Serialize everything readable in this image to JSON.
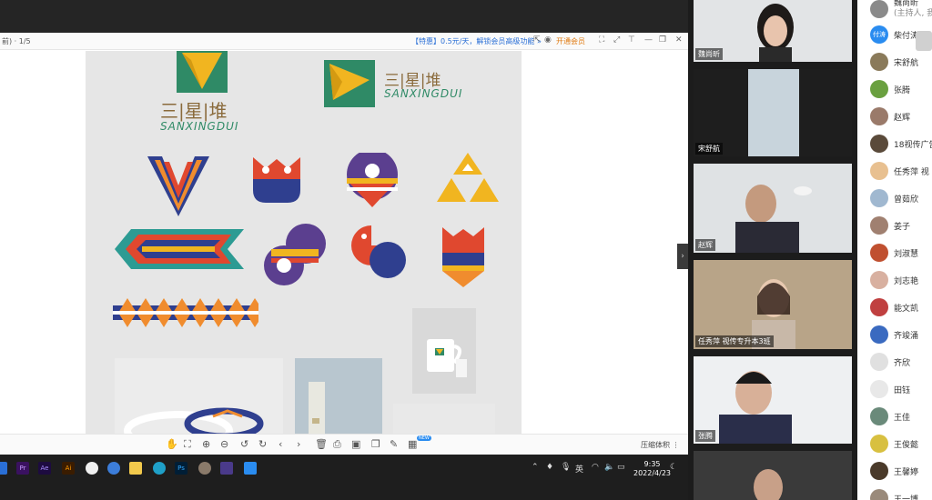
{
  "viewer": {
    "page": "前) · 1/5",
    "promo": "【特惠】0.5元/天，解锁会员高级功能 »",
    "vip": "开通会员",
    "compress": "压缩体积 ⋮",
    "badge": "NEW"
  },
  "logos": {
    "cn": "三|星|堆",
    "en": "SANXINGDUI"
  },
  "taskbar": {
    "apps": [
      "Pr",
      "Ae",
      "Ai",
      "Ps"
    ],
    "ime": "英",
    "time": "9:35",
    "date": "2022/4/23"
  },
  "videos": [
    {
      "name": "魏尚昕"
    },
    {
      "name": "宋舒航"
    },
    {
      "name": "赵辉"
    },
    {
      "name": "任秀萍",
      "tag": "视传专升本3班"
    },
    {
      "name": "张腾"
    }
  ],
  "participants": {
    "top": {
      "name": "魏尚昕",
      "sub": "(主持人, 我"
    },
    "list": [
      "柴付涛",
      "宋舒航",
      "张腾",
      "赵辉",
      "18视传广告",
      "任秀萍 视",
      "曾茹欣",
      "姜子",
      "刘淑慧",
      "刘志艳",
      "能文凯",
      "齐竣涌",
      "齐欣",
      "田钰",
      "王佳",
      "王俊懿",
      "王馨婷",
      "王一博"
    ],
    "host_initials": "付涛"
  },
  "colors": {
    "green": "#2f8a66",
    "yellow": "#f1b520",
    "blue": "#2f3f8f",
    "red": "#e0482f",
    "purple": "#5b3f8f",
    "orange": "#f08c2e",
    "teal": "#2c9b93"
  }
}
